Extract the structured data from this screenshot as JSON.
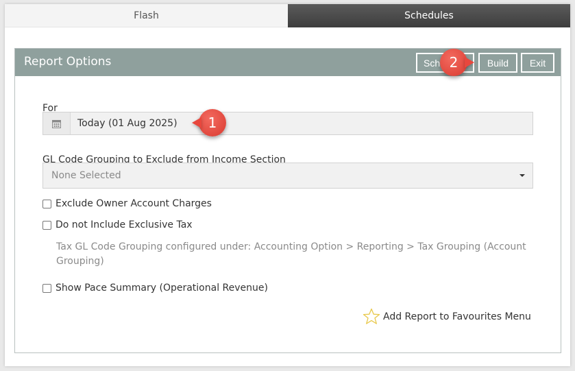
{
  "tabs": [
    {
      "label": "Flash",
      "active": false
    },
    {
      "label": "Schedules",
      "active": true
    }
  ],
  "panel": {
    "title": "Report Options",
    "buttons": {
      "schedule_label": "Schedule",
      "build_label": "Build",
      "exit_label": "Exit"
    }
  },
  "form": {
    "for_label": "For",
    "for_value": "Today (01 Aug 2025)",
    "gl_label": "GL Code Grouping to Exclude from Income Section",
    "gl_selected": "None Selected",
    "checkboxes": [
      {
        "label": "Exclude Owner Account Charges",
        "checked": false
      },
      {
        "label": "Do not Include Exclusive Tax",
        "checked": false
      },
      {
        "label": "Show Pace Summary (Operational Revenue)",
        "checked": false
      }
    ],
    "tax_help": "Tax GL Code Grouping configured under: Accounting Option > Reporting > Tax Grouping (Account Grouping)"
  },
  "favourites_label": "Add Report to Favourites Menu",
  "callouts": [
    {
      "number": "1"
    },
    {
      "number": "2"
    }
  ],
  "colors": {
    "header_bg": "#8fa09d",
    "active_tab_bg": "#3d3d3d",
    "callout": "#e8473d",
    "star": "#e8c84a"
  },
  "icons": {
    "date": "calendar-icon",
    "dropdown": "chevron-down-icon",
    "favourite": "star-icon"
  }
}
